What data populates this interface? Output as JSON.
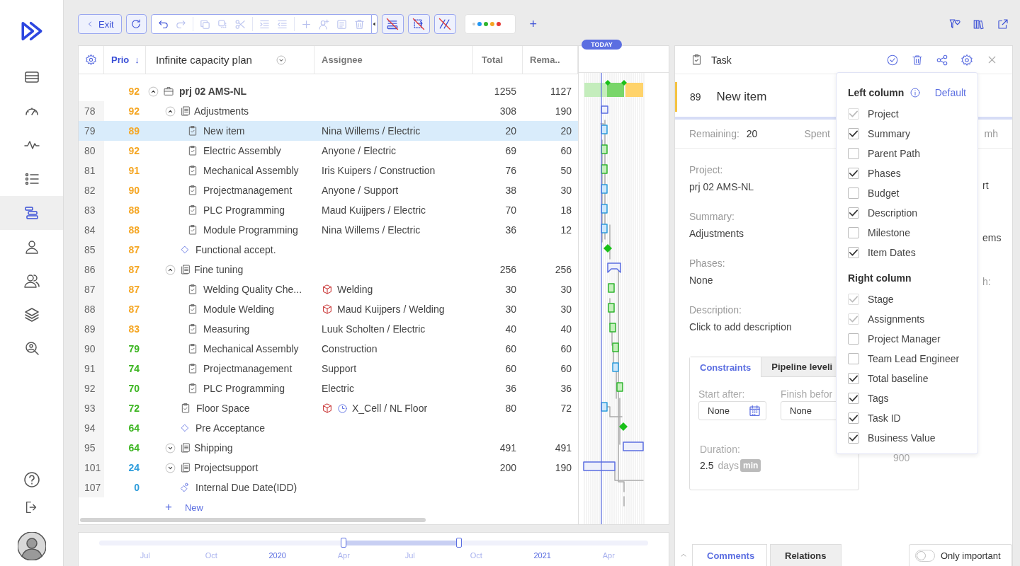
{
  "sidebar": {
    "items": [
      {
        "selected": false
      },
      {
        "selected": false
      },
      {
        "selected": false
      },
      {
        "selected": false
      },
      {
        "selected": true
      },
      {
        "selected": false
      },
      {
        "selected": false
      },
      {
        "selected": false
      },
      {
        "selected": false
      }
    ]
  },
  "toolbar": {
    "exit": "Exit",
    "tools": [
      {
        "disabled": false
      },
      {
        "disabled": true
      },
      {
        "disabled": true
      },
      {
        "disabled": true
      },
      {
        "disabled": true
      },
      {
        "disabled": true
      },
      {
        "disabled": true
      },
      {
        "disabled": true
      },
      {
        "disabled": true
      },
      {
        "disabled": true
      },
      {
        "disabled": true
      }
    ],
    "toggles": [
      {
        "on": false
      },
      {
        "on": false
      },
      {
        "on": false
      }
    ],
    "color_dots": [
      {
        "color": "#cccccc"
      },
      {
        "color": "#2196f3"
      },
      {
        "color": "#2fb52f"
      },
      {
        "color": "#f5a623"
      },
      {
        "color": "#e53935"
      }
    ],
    "add": "+"
  },
  "table": {
    "columns": [
      {
        "label": "Prio",
        "sort_arrow": "↓"
      },
      {
        "label": "Infinite capacity plan"
      },
      {
        "label": "Assignee"
      },
      {
        "label": "Total"
      },
      {
        "label": "Rema.."
      }
    ],
    "rows": [
      {
        "prio": "92",
        "color": "#f5a623",
        "kind": "project",
        "name": "prj 02 AMS-NL",
        "expanded": true,
        "selected": false,
        "total": "1255",
        "remaining": "1127",
        "children": [
          {
            "id": "78",
            "prio": "92",
            "color": "#f5a623",
            "kind": "summary",
            "name": "Adjustments",
            "expanded": true,
            "selected": false,
            "total": "308",
            "remaining": "190",
            "children": [
              {
                "id": "79",
                "prio": "89",
                "color": "#f5a623",
                "kind": "task",
                "name": "New item",
                "selected": true,
                "assignee": "Nina Willems / Electric",
                "total": "20",
                "remaining": "20"
              },
              {
                "id": "80",
                "prio": "92",
                "color": "#f5a623",
                "kind": "task",
                "name": "Electric Assembly",
                "selected": false,
                "assignee": "Anyone / Electric",
                "total": "69",
                "remaining": "60"
              },
              {
                "id": "81",
                "prio": "91",
                "color": "#f5a623",
                "kind": "task",
                "name": "Mechanical Assembly",
                "selected": false,
                "assignee": "Iris Kuipers / Construction",
                "total": "76",
                "remaining": "50"
              },
              {
                "id": "82",
                "prio": "90",
                "color": "#f5a623",
                "kind": "task",
                "name": "Projectmanagement",
                "selected": false,
                "assignee": "Anyone / Support",
                "total": "38",
                "remaining": "30"
              },
              {
                "id": "83",
                "prio": "88",
                "color": "#f5a623",
                "kind": "task",
                "name": "PLC Programming",
                "selected": false,
                "assignee": "Maud Kuijpers / Electric",
                "total": "70",
                "remaining": "18"
              },
              {
                "id": "84",
                "prio": "88",
                "color": "#f5a623",
                "kind": "task",
                "name": "Module Programming",
                "selected": false,
                "assignee": "Nina Willems / Electric",
                "total": "36",
                "remaining": "12"
              }
            ]
          },
          {
            "id": "85",
            "prio": "87",
            "color": "#f5a623",
            "kind": "milestone",
            "name": "Functional accept.",
            "selected": false
          },
          {
            "id": "86",
            "prio": "87",
            "color": "#f5a623",
            "kind": "summary",
            "name": "Fine tuning",
            "expanded": true,
            "selected": false,
            "total": "256",
            "remaining": "256",
            "children": [
              {
                "id": "87",
                "prio": "87",
                "color": "#f5a623",
                "kind": "task",
                "name": "Welding Quality Che...",
                "selected": false,
                "assignee": "Welding",
                "cube_icon": true,
                "total": "30",
                "remaining": "30"
              },
              {
                "id": "88",
                "prio": "87",
                "color": "#f5a623",
                "kind": "task",
                "name": "Module Welding",
                "selected": false,
                "assignee": "Maud Kuijpers / Welding",
                "cube_icon": true,
                "total": "30",
                "remaining": "30"
              },
              {
                "id": "89",
                "prio": "83",
                "color": "#f5a623",
                "kind": "task",
                "name": "Measuring",
                "selected": false,
                "assignee": "Luuk Scholten / Electric",
                "total": "40",
                "remaining": "40"
              },
              {
                "id": "90",
                "prio": "79",
                "color": "#3cb521",
                "kind": "task",
                "name": "Mechanical Assembly",
                "selected": false,
                "assignee": "Construction",
                "total": "60",
                "remaining": "60"
              },
              {
                "id": "91",
                "prio": "74",
                "color": "#3cb521",
                "kind": "task",
                "name": "Projectmanagement",
                "selected": false,
                "assignee": "Support",
                "total": "60",
                "remaining": "60"
              },
              {
                "id": "92",
                "prio": "70",
                "color": "#3cb521",
                "kind": "task",
                "name": "PLC Programming",
                "selected": false,
                "assignee": "Electric",
                "total": "36",
                "remaining": "36"
              }
            ]
          },
          {
            "id": "93",
            "prio": "72",
            "color": "#3cb521",
            "kind": "task",
            "name": "Floor Space",
            "selected": false,
            "assignee": "X_Cell / NL Floor",
            "cube_icon": true,
            "clock_icon": true,
            "total": "80",
            "remaining": "72"
          },
          {
            "id": "94",
            "prio": "64",
            "color": "#3cb521",
            "kind": "milestone",
            "name": "Pre Acceptance",
            "selected": false
          },
          {
            "id": "95",
            "prio": "64",
            "color": "#3cb521",
            "kind": "summary",
            "name": "Shipping",
            "expanded": false,
            "selected": false,
            "total": "491",
            "remaining": "491"
          },
          {
            "id": "101",
            "prio": "24",
            "color": "#2d9cdb",
            "kind": "summary",
            "name": "Projectsupport",
            "expanded": false,
            "selected": false,
            "total": "200",
            "remaining": "190"
          },
          {
            "id": "107",
            "prio": "0",
            "color": "#2d9cdb",
            "kind": "due_date",
            "name": "Internal Due Date(IDD)",
            "selected": false
          }
        ]
      }
    ],
    "new_row": {
      "icon": "+",
      "label": "New"
    }
  },
  "gantt": {
    "today_label": "TODAY"
  },
  "timeline": {
    "labels": [
      {
        "text": "Jul",
        "year": false
      },
      {
        "text": "Oct",
        "year": false
      },
      {
        "text": "2020",
        "year": true
      },
      {
        "text": "Apr",
        "year": false
      },
      {
        "text": "Jul",
        "year": false
      },
      {
        "text": "Oct",
        "year": false
      },
      {
        "text": "2021",
        "year": true
      },
      {
        "text": "Apr",
        "year": false
      }
    ],
    "handles": [
      {
        "level": 0.445
      },
      {
        "level": 0.655
      }
    ]
  },
  "task_panel": {
    "title": "Task",
    "item_id": "89",
    "item_name": "New item",
    "stats": [
      {
        "label": "Remaining:",
        "value": "20"
      },
      {
        "label": "Spent"
      }
    ],
    "unit": "mh",
    "fields": [
      {
        "label": "Project:",
        "value": "prj 02 AMS-NL"
      },
      {
        "label": "Summary:",
        "value": "Adjustments"
      },
      {
        "label": "Phases:",
        "value": "None"
      },
      {
        "label": "Description:",
        "value": "Click to add description"
      }
    ],
    "constraint_tabs": [
      {
        "label": "Constraints",
        "selected": true
      },
      {
        "label": "Pipeline leveli",
        "selected": false
      }
    ],
    "dates": [
      {
        "label": "Start after:",
        "value": "None",
        "calendar_icon": true
      },
      {
        "label": "Finish befor",
        "value": "None",
        "calendar_icon": false
      }
    ],
    "duration": {
      "label": "Duration:",
      "value": "2.5",
      "unit": "days",
      "badge": "min"
    },
    "right_fragments": [
      "rt",
      "ems",
      "h:"
    ],
    "right_value": "900",
    "bottom_tabs": [
      {
        "label": "Comments",
        "selected": true
      },
      {
        "label": "Relations",
        "selected": false
      }
    ],
    "only_important": {
      "label": "Only important",
      "on": false
    }
  },
  "column_menu": {
    "default_link": "Default",
    "sections": [
      {
        "title": "Left column",
        "items": [
          {
            "label": "Project",
            "checked": true,
            "disabled": true
          },
          {
            "label": "Summary",
            "checked": true,
            "disabled": false
          },
          {
            "label": "Parent Path",
            "checked": false,
            "disabled": false
          },
          {
            "label": "Phases",
            "checked": true,
            "disabled": false
          },
          {
            "label": "Budget",
            "checked": false,
            "disabled": false
          },
          {
            "label": "Description",
            "checked": true,
            "disabled": false
          },
          {
            "label": "Milestone",
            "checked": false,
            "disabled": false
          },
          {
            "label": "Item Dates",
            "checked": true,
            "disabled": false
          }
        ]
      },
      {
        "title": "Right column",
        "items": [
          {
            "label": "Stage",
            "checked": true,
            "disabled": true
          },
          {
            "label": "Assignments",
            "checked": true,
            "disabled": true
          },
          {
            "label": "Project Manager",
            "checked": false,
            "disabled": false
          },
          {
            "label": "Team Lead Engineer",
            "checked": false,
            "disabled": false
          },
          {
            "label": "Total baseline",
            "checked": true,
            "disabled": false
          },
          {
            "label": "Tags",
            "checked": true,
            "disabled": false
          },
          {
            "label": "Task ID",
            "checked": true,
            "disabled": false
          },
          {
            "label": "Business Value",
            "checked": true,
            "disabled": false
          }
        ]
      }
    ]
  }
}
